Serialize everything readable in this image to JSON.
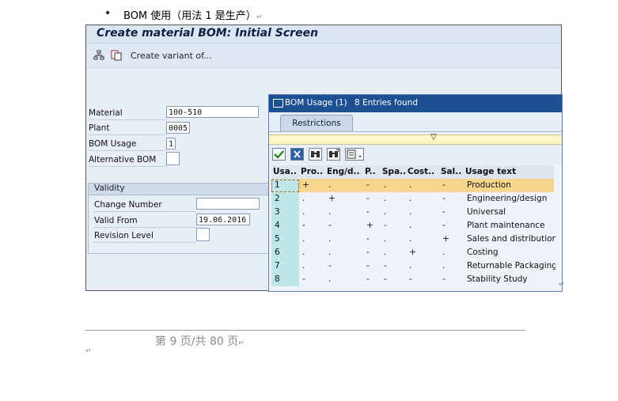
{
  "document": {
    "bullet": "•",
    "heading": "BOM 使用（用法 1 是生产）",
    "footer": "第 9 页/共 80 页",
    "paragraph_mark": "↵"
  },
  "sap": {
    "title": "Create material BOM: Initial Screen",
    "toolbar": {
      "variant_label": "Create variant of..."
    },
    "fields": [
      {
        "label": "Material",
        "value": "100-510"
      },
      {
        "label": "Plant",
        "value": "0005"
      },
      {
        "label": "BOM Usage",
        "value": "1"
      },
      {
        "label": "Alternative BOM",
        "value": ""
      }
    ],
    "validity": {
      "title": "Validity",
      "fields": [
        {
          "label": "Change Number",
          "value": ""
        },
        {
          "label": "Valid From",
          "value": "19.06.2016"
        },
        {
          "label": "Revision Level",
          "value": ""
        }
      ]
    }
  },
  "popup": {
    "title": "BOM Usage (1)",
    "entries_found": "8 Entries found",
    "tab": "Restrictions",
    "collapse_glyph": "▽",
    "columns": [
      "Usa..",
      "Pro..",
      "Eng/d..",
      "P..",
      "Spa..",
      "Cost..",
      "Sal..",
      "Usage text"
    ],
    "rows": [
      [
        "1",
        "+",
        ".",
        "-",
        ".",
        ".",
        "-",
        "Production"
      ],
      [
        ".",
        ".",
        "+",
        "-",
        ".",
        ".",
        "-",
        "Engineering/design"
      ],
      [
        "3",
        ".",
        ".",
        "-",
        ".",
        ".",
        "-",
        "Universal"
      ],
      [
        "4",
        "-",
        "-",
        "+",
        "-",
        ".",
        "-",
        "Plant maintenance"
      ],
      [
        "5",
        ".",
        ".",
        "-",
        ".",
        ".",
        "+",
        "Sales and distribution"
      ],
      [
        "6",
        ".",
        ".",
        "-",
        ".",
        "+",
        ".",
        "Costing"
      ],
      [
        "7",
        ".",
        "-",
        "-",
        "-",
        ".",
        ".",
        "Returnable Packaging"
      ],
      [
        "8",
        "-",
        ".",
        "-",
        "-",
        "-",
        "-",
        "Stability Study"
      ]
    ],
    "row_numbers": [
      "1",
      "2",
      "3",
      "4",
      "5",
      "6",
      "7",
      "8"
    ],
    "colors": {
      "selected_row": "#f5d68c",
      "key_column": "#bfe7ea",
      "header_row": "#dde5ef",
      "title_bar": "#1d4f93"
    }
  }
}
